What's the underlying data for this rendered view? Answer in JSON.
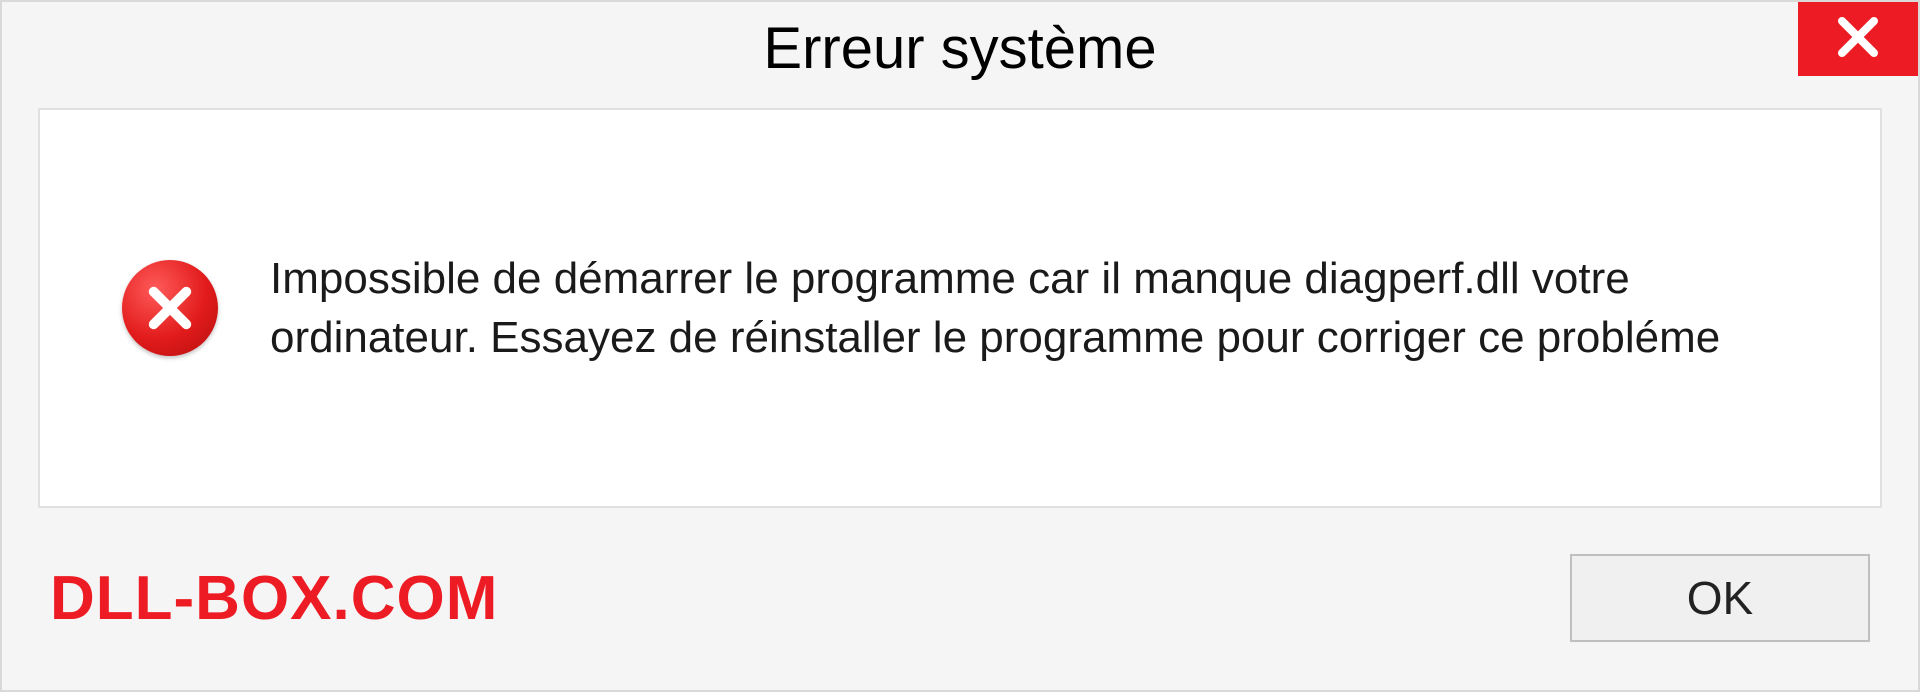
{
  "dialog": {
    "title": "Erreur système",
    "message": "Impossible de démarrer le programme car il manque diagperf.dll votre ordinateur. Essayez de réinstaller le programme pour corriger ce probléme",
    "brand": "DLL-BOX.COM",
    "ok_label": "OK"
  },
  "colors": {
    "accent_red": "#ed1c24",
    "panel_bg": "#f5f5f5",
    "content_bg": "#ffffff"
  }
}
